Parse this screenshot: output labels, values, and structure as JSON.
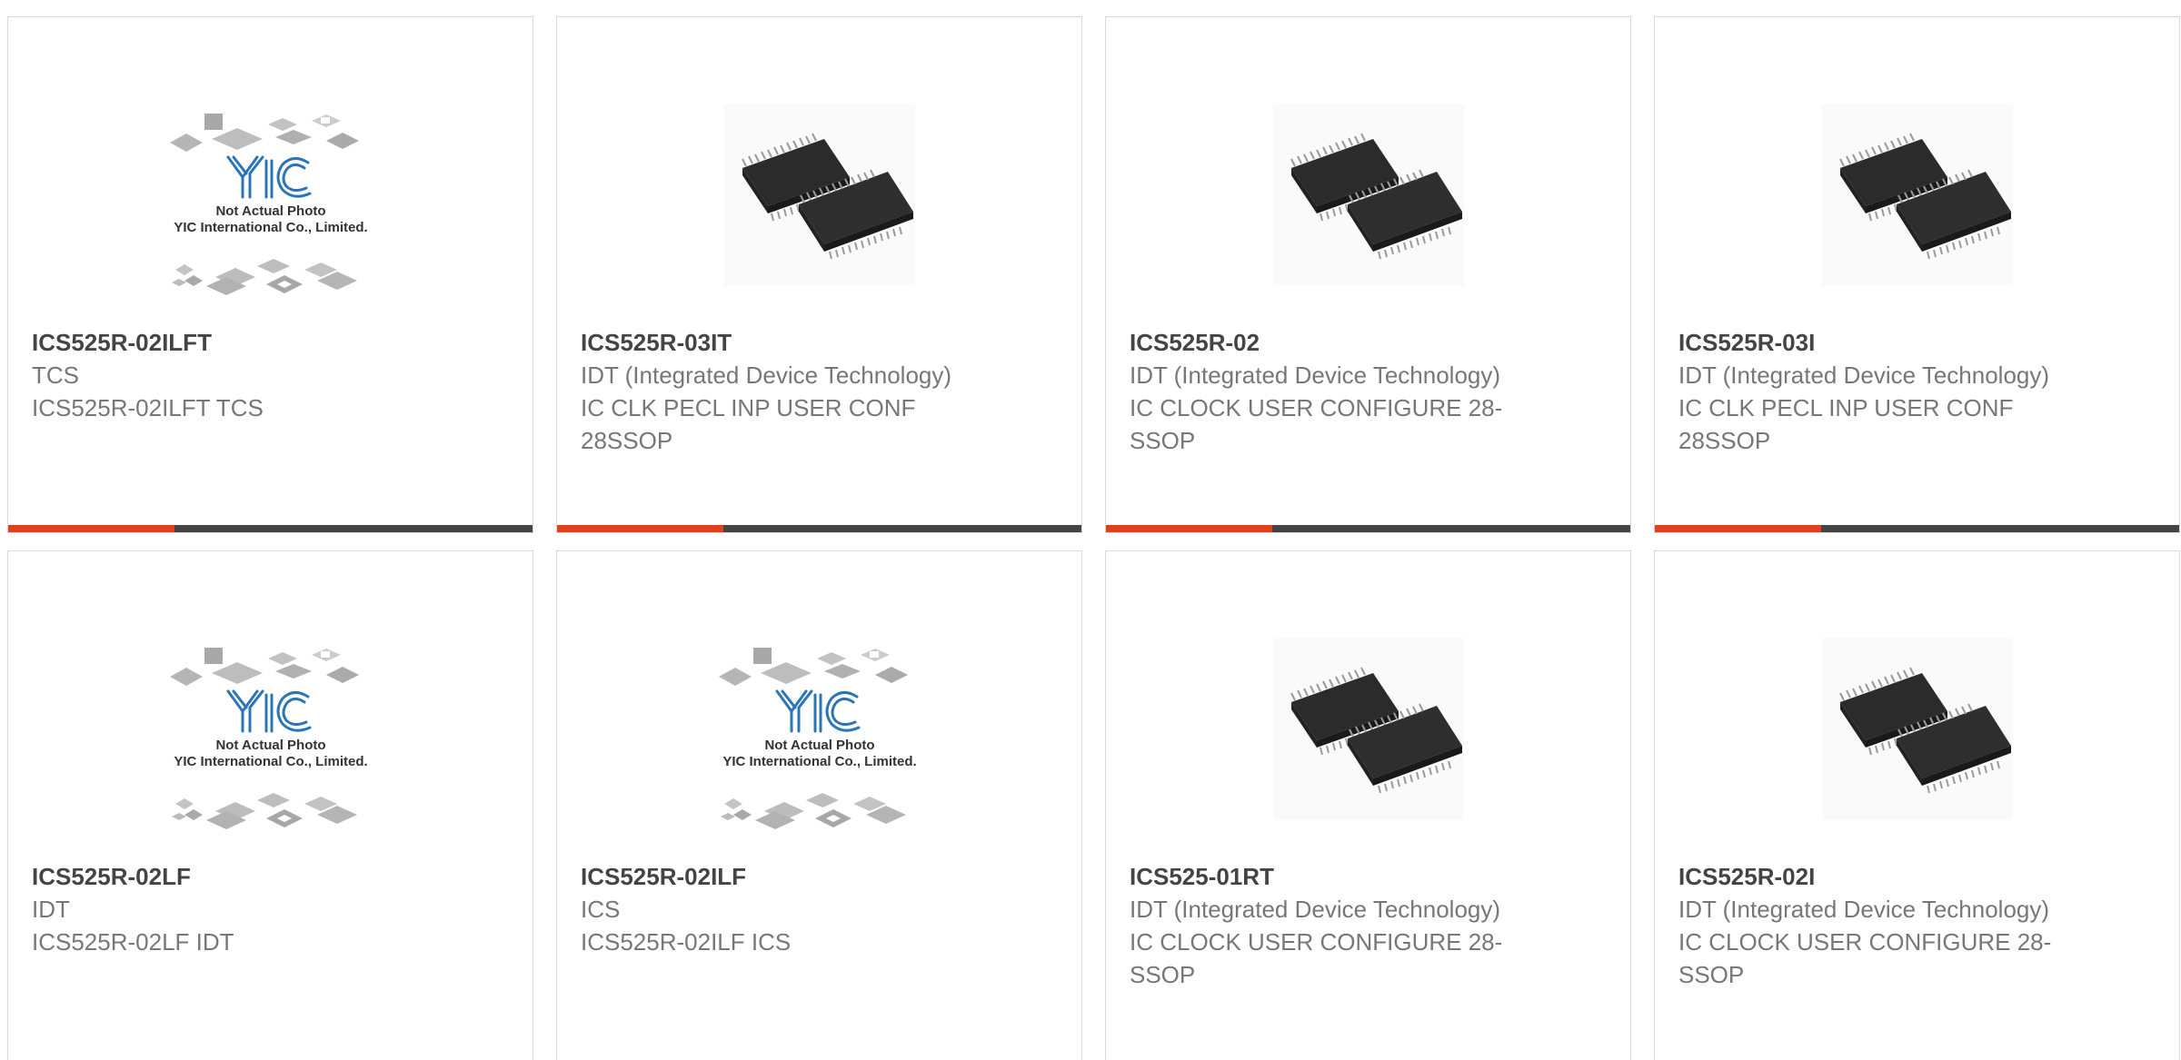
{
  "colors": {
    "accent": "#e0401c",
    "bar": "#444444",
    "title": "#444444",
    "text": "#777777",
    "logo": "#2a74b8"
  },
  "placeholder_image": {
    "line1": "Not Actual Photo",
    "line2": "YIC International Co., Limited."
  },
  "products": [
    {
      "part_number": "ICS525R-02ILFT",
      "manufacturer": "TCS",
      "description": "ICS525R-02ILFT TCS",
      "image": "placeholder"
    },
    {
      "part_number": "ICS525R-03IT",
      "manufacturer": "IDT (Integrated Device Technology)",
      "description": "IC CLK PECL INP USER CONF 28SSOP",
      "image": "ssop-chip"
    },
    {
      "part_number": "ICS525R-02",
      "manufacturer": "IDT (Integrated Device Technology)",
      "description": "IC CLOCK USER CONFIGURE 28-SSOP",
      "image": "ssop-chip"
    },
    {
      "part_number": "ICS525R-03I",
      "manufacturer": "IDT (Integrated Device Technology)",
      "description": "IC CLK PECL INP USER CONF 28SSOP",
      "image": "ssop-chip"
    },
    {
      "part_number": "ICS525R-02LF",
      "manufacturer": "IDT",
      "description": "ICS525R-02LF IDT",
      "image": "placeholder"
    },
    {
      "part_number": "ICS525R-02ILF",
      "manufacturer": "ICS",
      "description": "ICS525R-02ILF ICS",
      "image": "placeholder"
    },
    {
      "part_number": "ICS525-01RT",
      "manufacturer": "IDT (Integrated Device Technology)",
      "description": "IC CLOCK USER CONFIGURE 28-SSOP",
      "image": "ssop-chip"
    },
    {
      "part_number": "ICS525R-02I",
      "manufacturer": "IDT (Integrated Device Technology)",
      "description": "IC CLOCK USER CONFIGURE 28-SSOP",
      "image": "ssop-chip"
    }
  ]
}
